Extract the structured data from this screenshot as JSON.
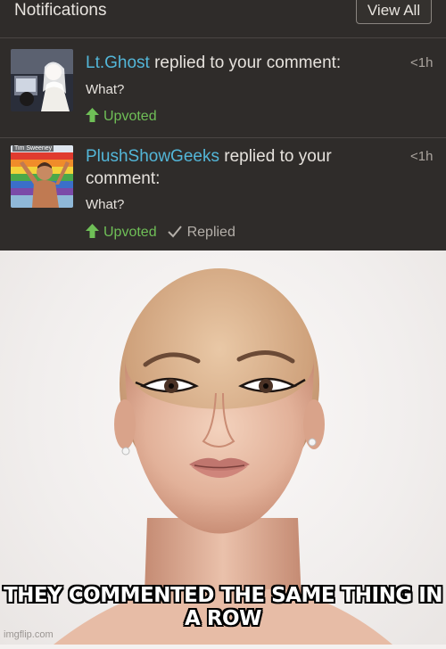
{
  "header": {
    "title": "Notifications",
    "view_all_label": "View All"
  },
  "notifications": [
    {
      "user": "Lt.Ghost",
      "action": " replied to your comment:",
      "time": "<1h",
      "quote": "What?",
      "status": "Upvoted"
    },
    {
      "user": "PlushShowGeeks",
      "action": " replied to your comment:",
      "time": "<1h",
      "quote": "What?",
      "status": "Upvoted",
      "replied": "Replied",
      "avatar_text": "Tim Sweeney"
    }
  ],
  "meme": {
    "caption_line1": "THEY COMMENTED THE SAME THING IN",
    "caption_line2": "A ROW",
    "watermark": "imgflip.com"
  },
  "colors": {
    "panel_bg": "#2f2c2a",
    "username": "#53b6d8",
    "upvote_green": "#6fbf57"
  }
}
